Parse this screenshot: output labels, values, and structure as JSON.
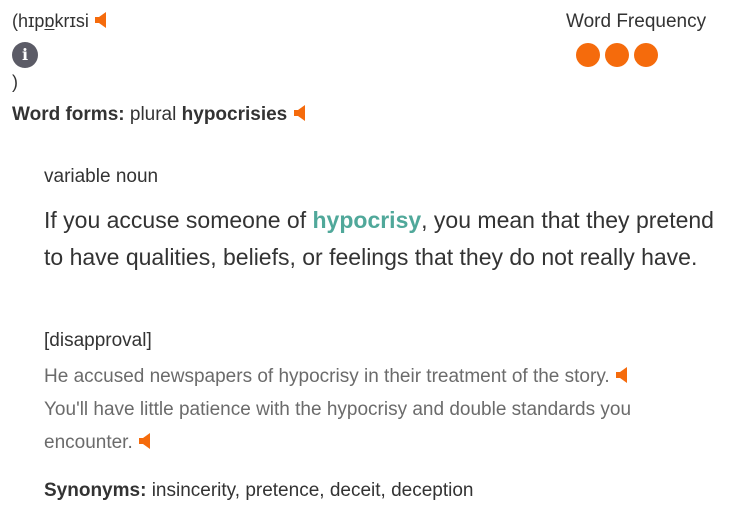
{
  "pronunciation": {
    "open": "(hɪp",
    "underlined": "ɒ",
    "rest": "krɪsi",
    "close": ")"
  },
  "word_frequency": {
    "title": "Word Frequency",
    "level": 3
  },
  "word_forms": {
    "label": "Word forms:",
    "type": "plural",
    "form": "hypocrisies"
  },
  "entry": {
    "part_of_speech": "variable noun",
    "definition_before": "If you accuse someone of ",
    "headword": "hypocrisy",
    "definition_after": ", you mean that they pretend to have qualities, beliefs, or feelings that they do not really have.",
    "register_label": "[disapproval]",
    "examples": [
      "He accused newspapers of hypocrisy in their treatment of the story.",
      "You'll have little patience with the hypocrisy and double standards you encounter."
    ],
    "synonyms_label": "Synonyms:",
    "synonyms": "insincerity, pretence, deceit, deception"
  },
  "colors": {
    "accent": "#f56b0c",
    "headword": "#50a89a",
    "info_icon": "#5b5b66"
  },
  "icons": {
    "speaker": "speaker-icon",
    "info": "info-icon"
  }
}
